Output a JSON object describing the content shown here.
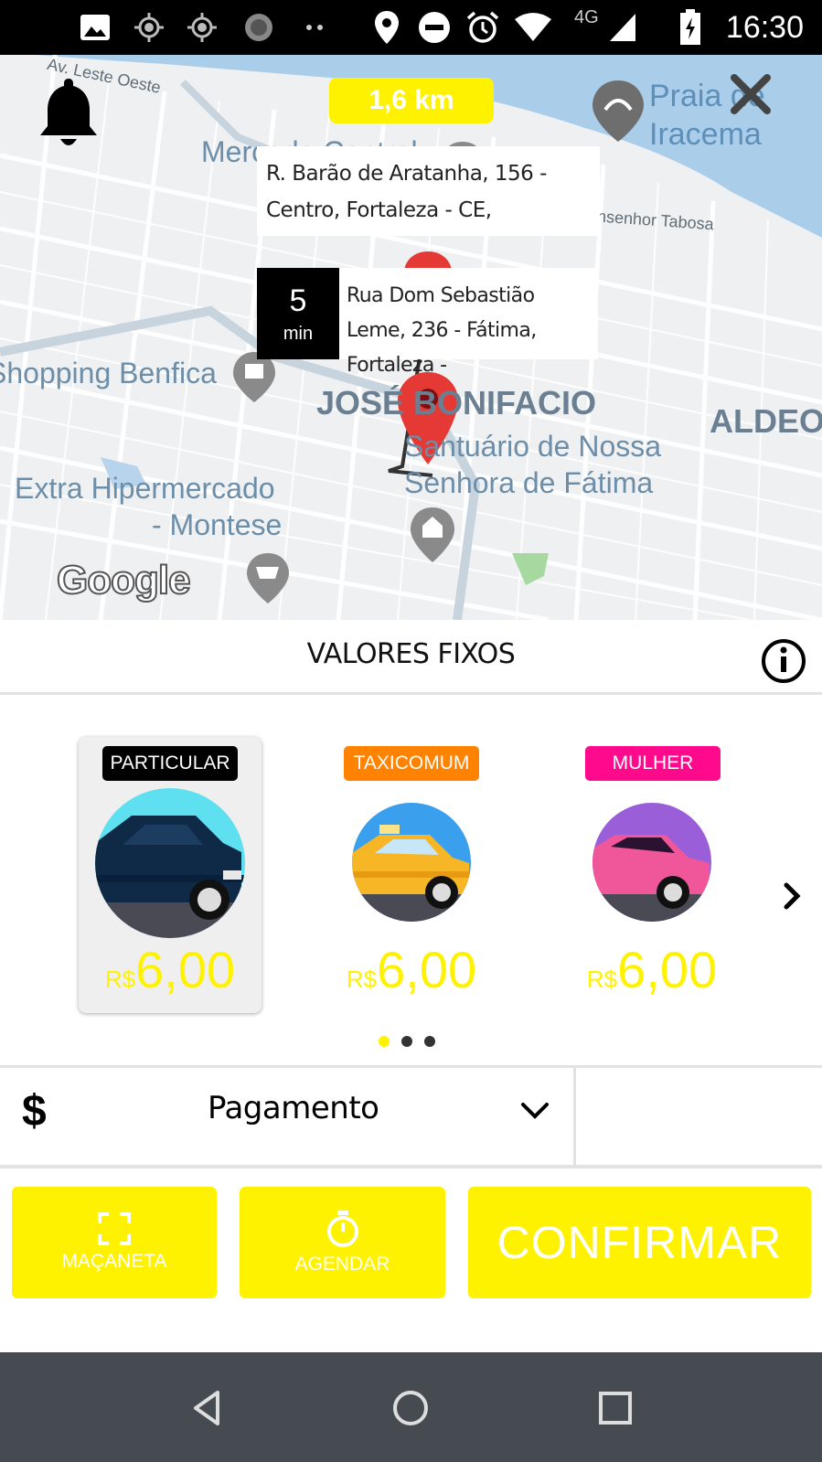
{
  "status_bar": {
    "time": "16:30",
    "network": "4G",
    "icons": [
      "image-icon",
      "gps-icon",
      "gps-icon",
      "sync-icon",
      "more-dots-icon",
      "location-pin-icon",
      "do-not-disturb-icon",
      "alarm-icon",
      "wifi-icon",
      "signal-icon",
      "battery-charging-icon"
    ]
  },
  "map": {
    "distance": "1,6 km",
    "origin_address": "R. Barão de Aratanha, 156 - Centro, Fortaleza - CE,",
    "eta_value": "5",
    "eta_unit": "min",
    "destination_address": "Rua Dom Sebastião Leme, 236 - Fátima, Fortaleza -",
    "labels": {
      "street_top": "Av. Leste Oeste",
      "mercado": "Mercado Central",
      "praia_1": "Praia de",
      "praia_2": "Iracema",
      "monsenhor": "Monsenhor Tabosa",
      "shopping": "Shopping Benfica",
      "bairro": "JOSÉ BONIFACIO",
      "aldeota": "ALDEOTA",
      "santuario_1": "Santuário de Nossa",
      "santuario_2": "Senhora de Fátima",
      "extra_1": "Extra Hipermercado",
      "extra_2": "- Montese",
      "google": "Google"
    }
  },
  "section": {
    "title": "VALORES FIXOS"
  },
  "vehicles": [
    {
      "badge": "PARTICULAR",
      "badge_color": "#000000",
      "currency": "R$",
      "price": "6,00",
      "selected": true
    },
    {
      "badge": "TAXICOMUM",
      "badge_color": "#ff8200",
      "currency": "R$",
      "price": "6,00",
      "selected": false
    },
    {
      "badge": "MULHER",
      "badge_color": "#ff0a8c",
      "currency": "R$",
      "price": "6,00",
      "selected": false
    }
  ],
  "pagination": {
    "active_index": 0,
    "count": 3
  },
  "payment": {
    "label": "Pagamento",
    "icon": "$"
  },
  "actions": {
    "macaneta": "MAÇANETA",
    "agendar": "AGENDAR",
    "confirmar": "CONFIRMAR"
  },
  "colors": {
    "accent_yellow": "#fff200",
    "nav_bar": "#454b51",
    "pin_red": "#e53935"
  }
}
